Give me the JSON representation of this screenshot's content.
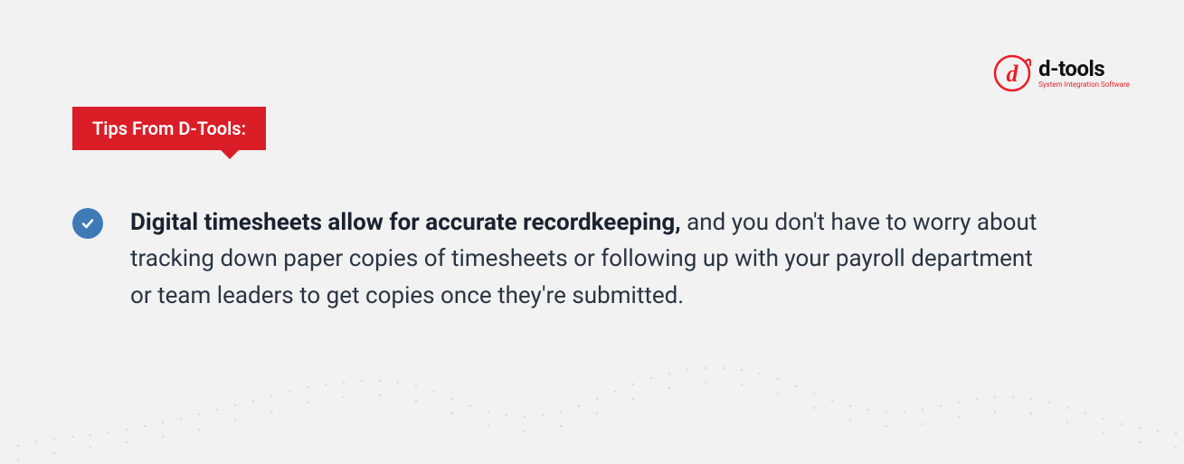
{
  "brand": {
    "name": "d-tools",
    "tagline": "System Integration Software",
    "accent": "#ee1c25"
  },
  "tag": {
    "label": "Tips From D-Tools:"
  },
  "tip": {
    "bold": "Digital timesheets allow for accurate recordkeeping,",
    "rest": " and you don't have to worry about tracking down paper copies of timesheets or following up with your payroll department or team leaders to get copies once they're submitted."
  }
}
